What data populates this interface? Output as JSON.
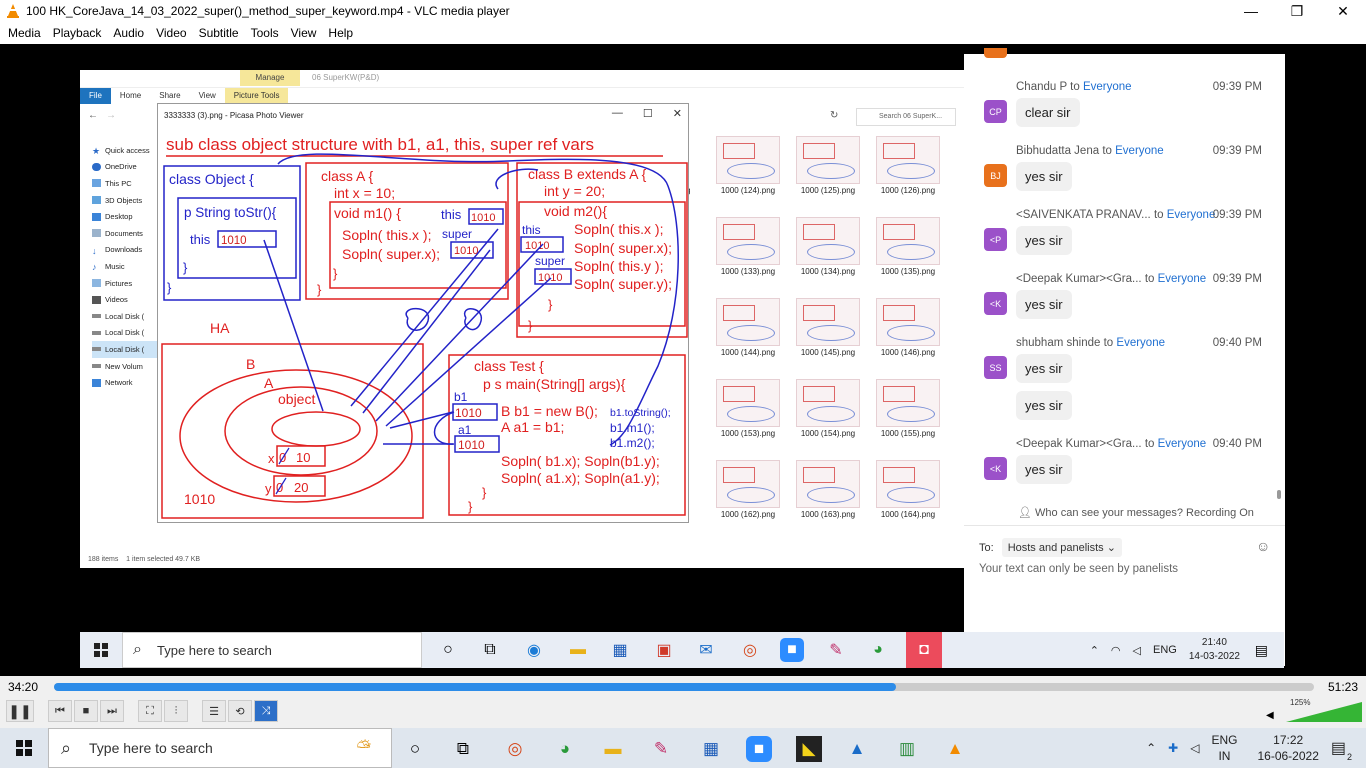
{
  "window": {
    "title": "100 HK_CoreJava_14_03_2022_super()_method_super_keyword.mp4 - VLC media player",
    "controls": [
      "—",
      "❐",
      "✕"
    ]
  },
  "menu": [
    "Media",
    "Playback",
    "Audio",
    "Video",
    "Subtitle",
    "Tools",
    "View",
    "Help"
  ],
  "explorer": {
    "manage_tab": "Manage",
    "window_title": "06 SuperKW(P&D)",
    "tabs": [
      "File",
      "Home",
      "Share",
      "View",
      "Picture Tools"
    ],
    "search_placeholder": "Search 06 SuperK...",
    "sidebar": [
      "Quick access",
      "OneDrive",
      "This PC",
      "3D Objects",
      "Desktop",
      "Documents",
      "Downloads",
      "Music",
      "Pictures",
      "Videos",
      "Local Disk (",
      "Local Disk (",
      "Local Disk (",
      "New Volum",
      "Network"
    ],
    "status_items": "188 items",
    "status_selected": "1 item selected  49.7 KB",
    "thumb_labels": [
      "1000 (124).png",
      "1000 (125).png",
      "1000 (126).png",
      "1000 (133).png",
      "1000 (134).png",
      "1000 (135).png",
      "1000 (144).png",
      "1000 (145).png",
      "1000 (146).png",
      "1000 (153).png",
      "1000 (154).png",
      "1000 (155).png",
      "1000 (162).png",
      "1000 (163).png",
      "1000 (164).png"
    ],
    "partial_label": "ng"
  },
  "picasa": {
    "title": "3333333 (3).png - Picasa Photo Viewer",
    "heading": "sub class object structure with b1, a1, this, super ref vars",
    "object_class": {
      "head": "class Object {",
      "method": "p String toStr(){",
      "this_label": "this",
      "this_val": "1010",
      "close1": "}",
      "close2": "}"
    },
    "class_a": {
      "head": "class A {",
      "field": "int x = 10;",
      "method": "void m1() {",
      "this_label": "this",
      "this_val": "1010",
      "line1": "Sopln( this.x );",
      "super_label": "super",
      "line2": "Sopln( super.x);",
      "super_val": "1010",
      "close1": "}",
      "close2": "}"
    },
    "class_b": {
      "head": "class B extends A {",
      "field": "int y = 20;",
      "method": "void m2(){",
      "this_label": "this",
      "this_val": "1010",
      "super_label": "super",
      "super_val": "1010",
      "l1": "Sopln( this.x );",
      "l2": "Sopln( super.x);",
      "l3": "Sopln( this.y );",
      "l4": "Sopln( super.y);",
      "close1": "}",
      "close2": "}"
    },
    "heap": {
      "label": "HA",
      "b": "B",
      "a": "A",
      "object": "object",
      "x_label": "x",
      "x_old": "0",
      "x_val": "10",
      "y_label": "y",
      "y_old": "0",
      "y_val": "20",
      "addr": "1010"
    },
    "test": {
      "head": "class Test {",
      "main": "p s main(String[] args){",
      "b1": "b1",
      "b1_val": "1010",
      "b1_stmt": "B b1 = new B();",
      "calls": [
        "b1.toString();",
        "b1.m1();",
        "b1.m2();"
      ],
      "a1": "a1",
      "a1_val": "1010",
      "a1_stmt": "A a1 = b1;",
      "print1": "Sopln( b1.x); Sopln(b1.y);",
      "print2": "Sopln( a1.x); Sopln(a1.y);",
      "close1": "}",
      "close2": "}"
    }
  },
  "chat": {
    "messages": [
      {
        "initials": "CP",
        "color": "#9b51c9",
        "sender": "Chandu P",
        "to": "to",
        "target": "Everyone",
        "time": "09:39 PM",
        "text": "clear sir"
      },
      {
        "initials": "BJ",
        "color": "#e8711c",
        "sender": "Bibhudatta Jena",
        "to": "to",
        "target": "Everyone",
        "time": "09:39 PM",
        "text": "yes sir"
      },
      {
        "initials": "<P",
        "color": "#9b51c9",
        "sender": "<SAIVENKATA PRANAV...",
        "to": "to",
        "target": "Everyone",
        "time": "09:39 PM",
        "text": "yes sir"
      },
      {
        "initials": "<K",
        "color": "#9b51c9",
        "sender": "<Deepak Kumar><Gra...",
        "to": "to",
        "target": "Everyone",
        "time": "09:39 PM",
        "text": "yes sir"
      },
      {
        "initials": "SS",
        "color": "#9b51c9",
        "sender": "shubham shinde",
        "to": "to",
        "target": "Everyone",
        "time": "09:40 PM",
        "text": "yes sir",
        "text2": "yes sir"
      },
      {
        "initials": "<K",
        "color": "#9b51c9",
        "sender": "<Deepak Kumar><Gra...",
        "to": "to",
        "target": "Everyone",
        "time": "09:40 PM",
        "text": "yes sir"
      }
    ],
    "who_can_see": "Who can see your messages? Recording On",
    "to_label": "To:",
    "recipient": "Hosts and panelists",
    "hint": "Your text can only be seen by panelists"
  },
  "video_taskbar": {
    "search": "Type here to search",
    "lang": "ENG",
    "time": "21:40",
    "date": "14-03-2022"
  },
  "controls": {
    "current_time": "34:20",
    "total_time": "51:23",
    "progress": 0.668,
    "volume_pct": "125%",
    "volume": 1.0
  },
  "taskbar": {
    "search": "Type here to search",
    "lang": "ENG",
    "lang2": "IN",
    "time": "17:22",
    "date": "16-06-2022",
    "notif": "2"
  }
}
